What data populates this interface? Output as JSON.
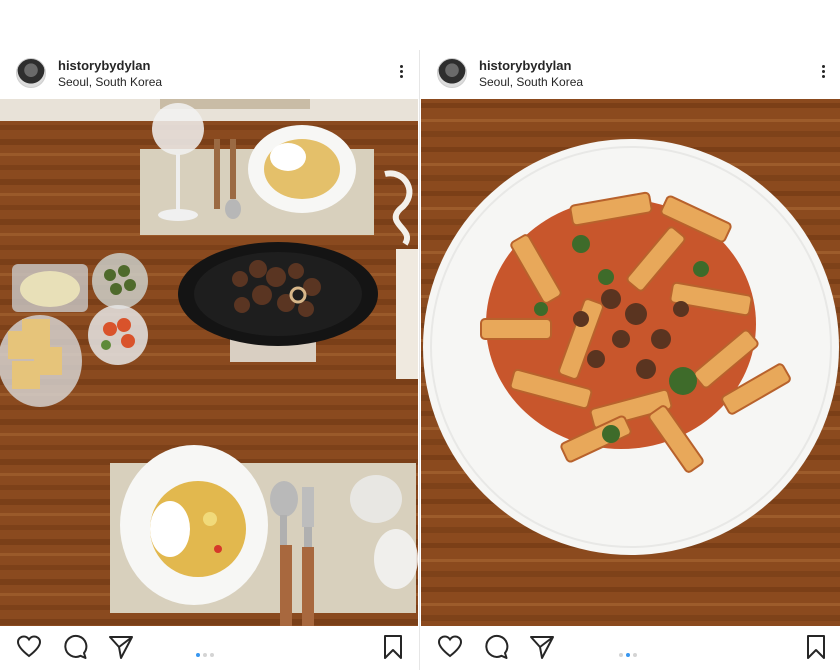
{
  "posts": [
    {
      "username": "historybydylan",
      "location": "Seoul, South Korea",
      "photo_subject": "table spread with curry rice, braised meat and side dishes",
      "carousel": {
        "count": 3,
        "active": 1
      },
      "icons": [
        "heart-icon",
        "comment-icon",
        "share-icon",
        "bookmark-icon",
        "more-icon"
      ]
    },
    {
      "username": "historybydylan",
      "location": "Seoul, South Korea",
      "photo_subject": "penne pasta with tomato meat sauce and broccoli",
      "carousel": {
        "count": 3,
        "active": 2
      },
      "icons": [
        "heart-icon",
        "comment-icon",
        "share-icon",
        "bookmark-icon",
        "more-icon"
      ]
    }
  ],
  "colors": {
    "text": "#262626",
    "active_dot": "#3897f0",
    "inactive_dot": "#d4d4d4",
    "wood": "#8a4a1f"
  }
}
